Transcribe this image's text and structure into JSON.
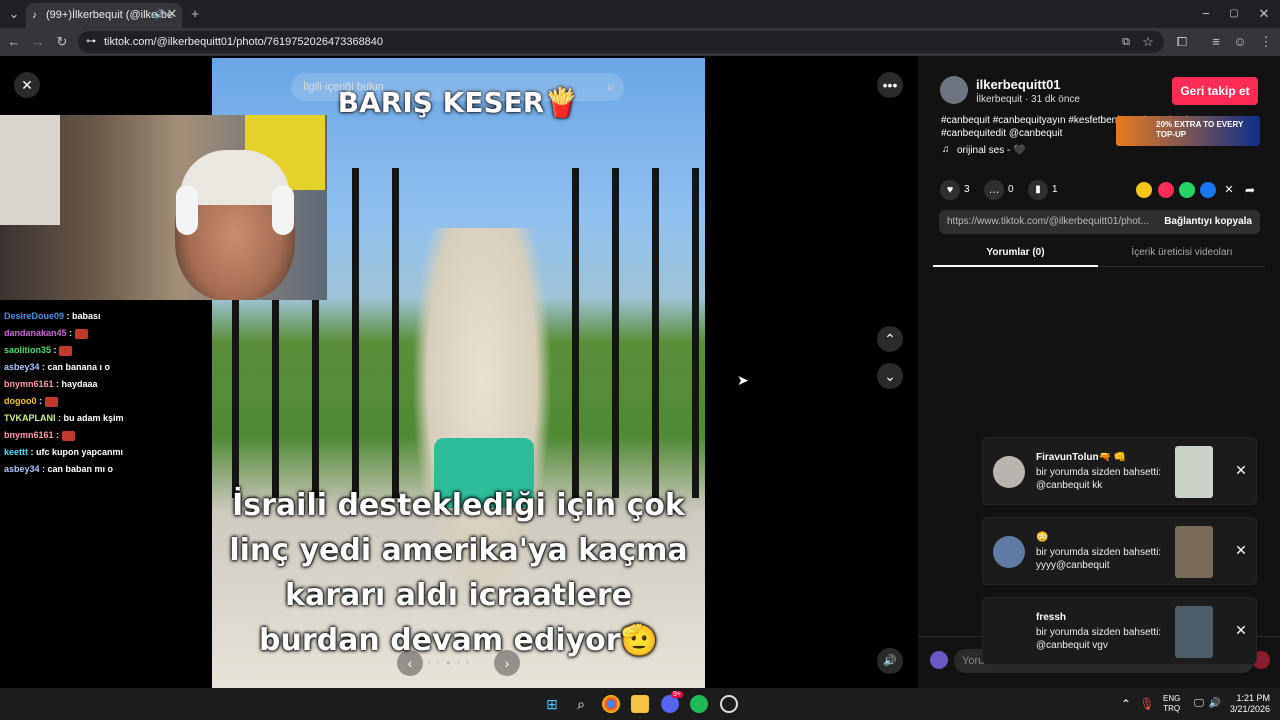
{
  "browser": {
    "tab_title": "(99+)İlkerbequit (@ilkerbe",
    "url": "tiktok.com/@ilkerbequitt01/photo/7619752026473368840"
  },
  "viewer": {
    "search_placeholder": "İlgili içeriği bulun",
    "photo_title": "BARIŞ KESER🍟",
    "caption": "İsraili desteklediği için çok linç yedi amerika'ya kaçma kararı aldı icraatlere burdan devam ediyor🫡"
  },
  "chat": [
    {
      "user": "DesireDoue09",
      "color": "#4a90e2",
      "msg": "babası",
      "emote": false
    },
    {
      "user": "dandanakan45",
      "color": "#c86bd6",
      "msg": "",
      "emote": true
    },
    {
      "user": "saolition35",
      "color": "#53d769",
      "msg": "",
      "emote": true
    },
    {
      "user": "asbey34",
      "color": "#b0c4ff",
      "msg": "can banana ı o",
      "emote": false
    },
    {
      "user": "bnymn6161",
      "color": "#ff9aa6",
      "msg": "haydaaa",
      "emote": false
    },
    {
      "user": "dogoo0",
      "color": "#f0c419",
      "msg": "",
      "emote": true
    },
    {
      "user": "TVKAPLANI",
      "color": "#c8f08f",
      "msg": "bu adam kşim",
      "emote": false
    },
    {
      "user": "bnymn6161",
      "color": "#ff9aa6",
      "msg": "",
      "emote": true
    },
    {
      "user": "keettt",
      "color": "#5ad1ff",
      "msg": "ufc kupon yapcanmı",
      "emote": false
    },
    {
      "user": "asbey34",
      "color": "#b0c4ff",
      "msg": "can baban mı o",
      "emote": false
    }
  ],
  "side": {
    "username": "ilkerbequitt01",
    "subline": "İlkerbequit · 31 dk önce",
    "follow_label": "Geri takip et",
    "hashtags": "#canbequit #canbequityayın #kesfetbeniöneçıkart #kesfet #canbequitedit @canbequit",
    "sound": "orijinal ses - 🖤",
    "ad_text": "20% EXTRA TO EVERY TOP-UP",
    "likes": "3",
    "comments": "0",
    "saves": "1",
    "link": "https://www.tiktok.com/@ilkerbequitt01/phot...",
    "copy_label": "Bağlantıyı kopyala",
    "tab_comments": "Yorumlar (0)",
    "tab_videos": "İçerik üreticisi videoları",
    "comment_placeholder": "Yorum ekle..."
  },
  "notifications": [
    {
      "name": "FiravunTolun🔫 👊",
      "text": "bir yorumda sizden bahsetti: @canbequit kk"
    },
    {
      "name": "😳",
      "text": "bir yorumda sizden bahsetti: yyyy@canbequit"
    },
    {
      "name": "fressh",
      "text": "bir yorumda sizden bahsetti: @canbequit vgv"
    }
  ],
  "taskbar": {
    "lang_top": "ENG",
    "lang_bottom": "TRQ",
    "time": "1:21 PM",
    "date": "3/21/2026",
    "badge": "9+"
  },
  "colors": {
    "accent": "#fe2c55",
    "panel_bg": "#121212",
    "chrome_bg": "#202124"
  }
}
